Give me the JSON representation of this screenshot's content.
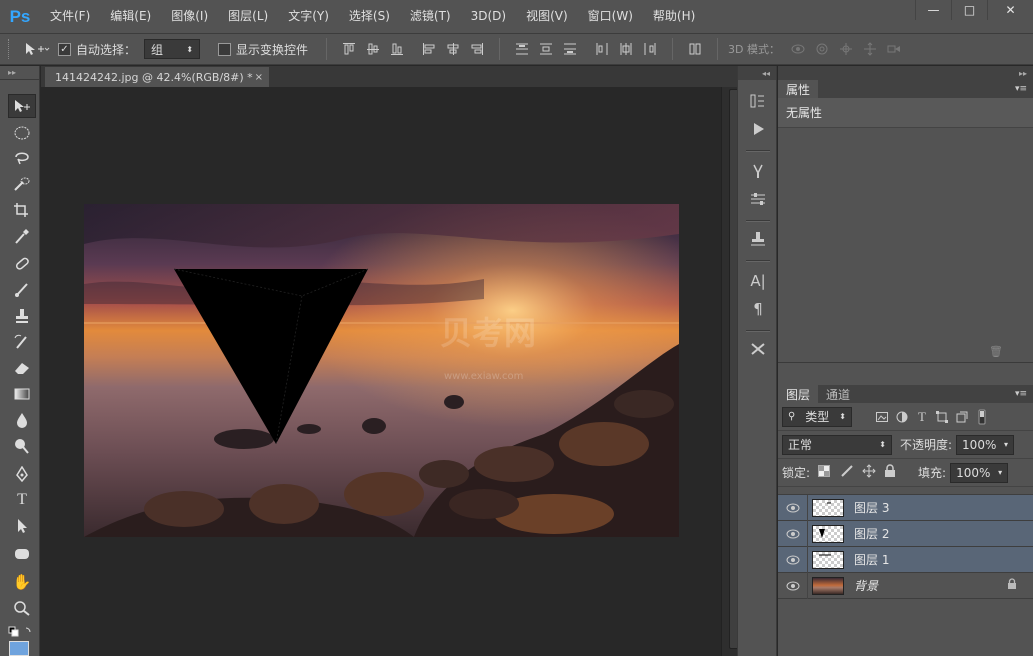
{
  "app": {
    "logo": "Ps"
  },
  "menu": [
    "文件(F)",
    "编辑(E)",
    "图像(I)",
    "图层(L)",
    "文字(Y)",
    "选择(S)",
    "滤镜(T)",
    "3D(D)",
    "视图(V)",
    "窗口(W)",
    "帮助(H)"
  ],
  "window_controls": {
    "minimize": "—",
    "maximize": "□",
    "close": "✕"
  },
  "options": {
    "auto_select_label": "自动选择：",
    "auto_select_value": "组",
    "show_transform_label": "显示变换控件",
    "three_d_mode_label": "3D 模式："
  },
  "document": {
    "tab_title": "141424242.jpg @ 42.4%(RGB/8#) *",
    "close": "×"
  },
  "watermark": {
    "main": "贝考网",
    "sub": "www.exiaw.com"
  },
  "properties": {
    "tab_label": "属性",
    "empty_text": "无属性"
  },
  "layers_panel": {
    "tabs": [
      "图层",
      "通道"
    ],
    "filter_value": "类型",
    "blend_mode": "正常",
    "opacity_label": "不透明度:",
    "opacity_value": "100%",
    "lock_label": "锁定:",
    "fill_label": "填充:",
    "fill_value": "100%",
    "layers": [
      {
        "name": "图层 3",
        "selected": true
      },
      {
        "name": "图层 2",
        "selected": true
      },
      {
        "name": "图层 1",
        "selected": true
      },
      {
        "name": "背景",
        "selected": false,
        "locked": true
      }
    ]
  },
  "colors": {
    "accent": "#33a6ff",
    "selected_layer": "#596677",
    "panel": "#535353",
    "canvas_bg": "#282828"
  }
}
